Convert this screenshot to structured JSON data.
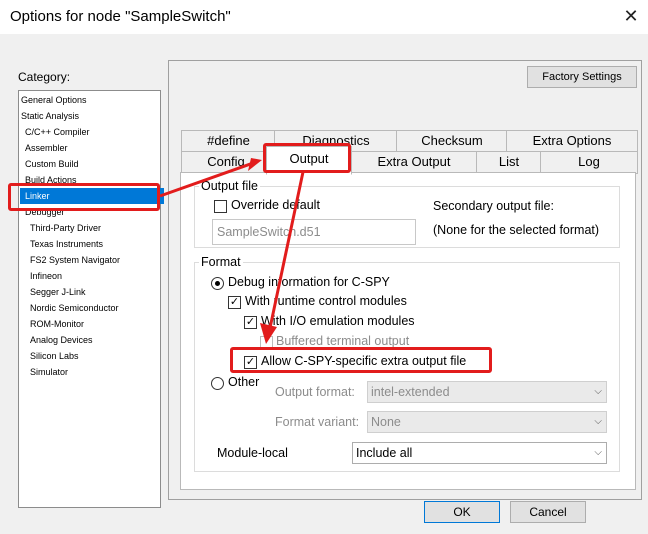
{
  "window": {
    "title": "Options for node \"SampleSwitch\""
  },
  "category": {
    "label": "Category:",
    "items": [
      "General Options",
      "Static Analysis",
      "C/C++ Compiler",
      "Assembler",
      "Custom Build",
      "Build Actions",
      "Linker",
      "Debugger",
      "Third-Party Driver",
      "Texas Instruments",
      "FS2 System Navigator",
      "Infineon",
      "Segger J-Link",
      "Nordic Semiconductor",
      "ROM-Monitor",
      "Analog Devices",
      "Silicon Labs",
      "Simulator"
    ]
  },
  "factory_settings": "Factory Settings",
  "tabs_row1": [
    "#define",
    "Diagnostics",
    "Checksum",
    "Extra Options"
  ],
  "tabs_row2": [
    "Config",
    "Output",
    "Extra Output",
    "List",
    "Log"
  ],
  "output_file": {
    "group_label": "Output file",
    "override_label": "Override default",
    "filename": "SampleSwitch.d51",
    "secondary_label": "Secondary output file:",
    "secondary_value": "(None for the selected format)"
  },
  "format": {
    "group_label": "Format",
    "debug_label": "Debug information for C-SPY",
    "runtime_label": "With runtime control modules",
    "io_label": "With I/O emulation modules",
    "buffered_label": "Buffered terminal output",
    "allow_label": "Allow C-SPY-specific extra output file",
    "other_label": "Other",
    "output_format_label": "Output format:",
    "output_format_value": "intel-extended",
    "format_variant_label": "Format variant:",
    "format_variant_value": "None"
  },
  "module_local": {
    "label": "Module-local",
    "value": "Include all"
  },
  "buttons": {
    "ok": "OK",
    "cancel": "Cancel"
  },
  "colors": {
    "highlight": "#e21c1c",
    "selection": "#0078d7"
  }
}
